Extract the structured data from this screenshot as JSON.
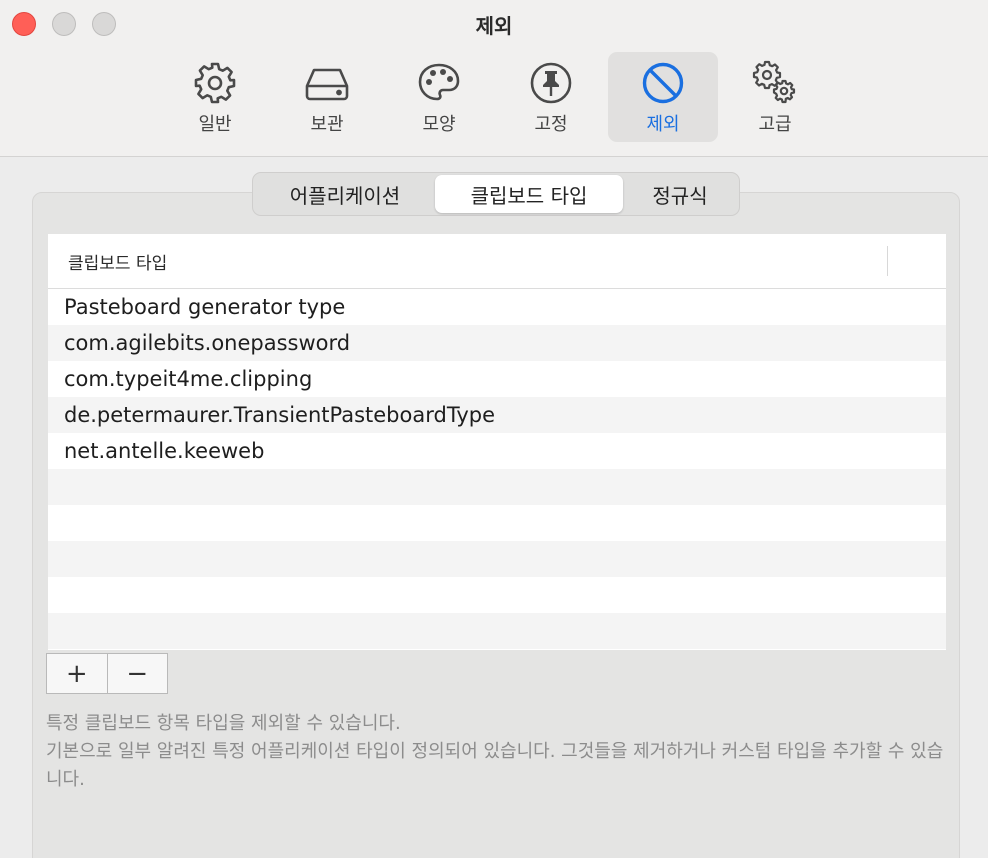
{
  "window": {
    "title": "제외"
  },
  "toolbar": {
    "items": [
      {
        "label": "일반",
        "icon": "gear-icon"
      },
      {
        "label": "보관",
        "icon": "drive-icon"
      },
      {
        "label": "모양",
        "icon": "palette-icon"
      },
      {
        "label": "고정",
        "icon": "pin-icon"
      },
      {
        "label": "제외",
        "icon": "prohibited-icon",
        "active": true
      },
      {
        "label": "고급",
        "icon": "gears-icon"
      }
    ],
    "accent": "#1a6fe0"
  },
  "tabs": {
    "items": [
      "어플리케이션",
      "클립보드 타입",
      "정규식"
    ],
    "selected": "클립보드 타입"
  },
  "table": {
    "column_header": "클립보드 타입",
    "rows": [
      "Pasteboard generator type",
      "com.agilebits.onepassword",
      "com.typeit4me.clipping",
      "de.petermaurer.TransientPasteboardType",
      "net.antelle.keeweb"
    ]
  },
  "buttons": {
    "add": "+",
    "remove": "−"
  },
  "description": {
    "line1": "특정 클립보드 항목 타입을 제외할 수 있습니다.",
    "line2": "기본으로 일부 알려진 특정 어플리케이션 타입이 정의되어 있습니다. 그것들을 제거하거나 커스텀 타입을 추가할 수 있습니다."
  }
}
